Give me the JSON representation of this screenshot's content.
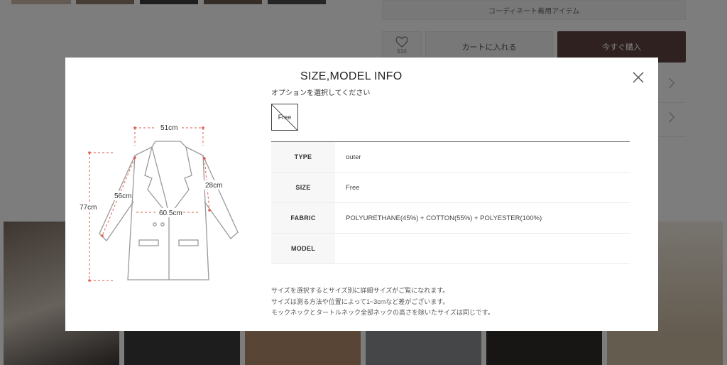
{
  "background": {
    "coordinate_label": "コーディネート着用アイテム",
    "wishlist": {
      "count": "510",
      "icon": "heart-icon"
    },
    "cart_label": "カートに入れる",
    "buy_label": "今すぐ購入"
  },
  "modal": {
    "title": "SIZE,MODEL INFO",
    "option_prompt": "オプションを選択してください",
    "option_value": "Free",
    "close_icon": "close-icon",
    "diagram": {
      "shoulder": "51cm",
      "length": "77cm",
      "sleeve": "56cm",
      "chest": "60.5cm",
      "armhole": "28cm"
    },
    "table": [
      {
        "key": "TYPE",
        "value": "outer"
      },
      {
        "key": "SIZE",
        "value": "Free"
      },
      {
        "key": "FABRIC",
        "value": "POLYURETHANE(45%) + COTTON(55%) + POLYESTER(100%)"
      },
      {
        "key": "MODEL",
        "value": ""
      }
    ],
    "notes": [
      "サイズを選択するとサイズ別に詳細サイズがご覧になれます。",
      "サイズは測る方法や位置によって1~3cmなど差がございます。",
      "モックネックとタートルネック全部ネックの高さを除いたサイズは同じです。"
    ]
  },
  "colors": {
    "buy_button": "#5d4340",
    "overlay": "rgba(0,0,0,0.5)",
    "measure_line": "#e05a4a"
  }
}
